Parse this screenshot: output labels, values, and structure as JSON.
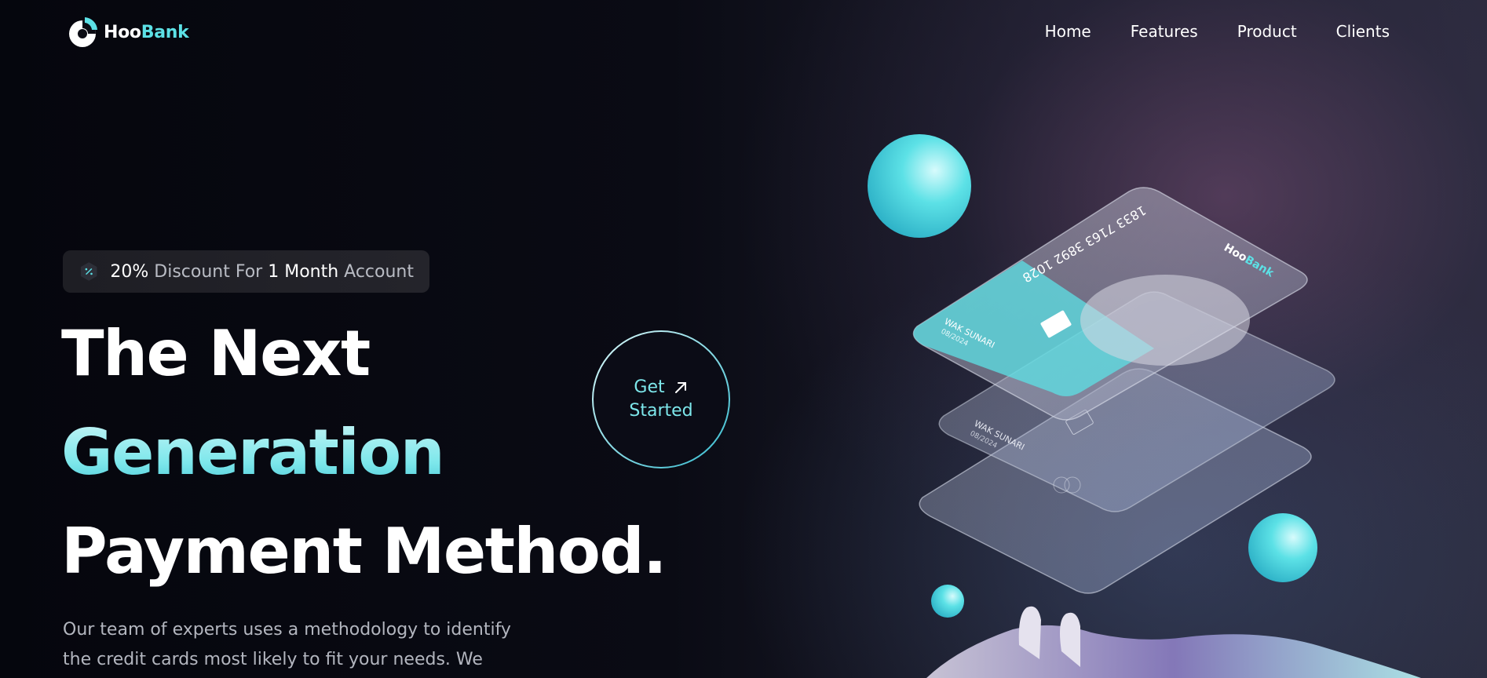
{
  "brand": {
    "name_part1": "Hoo",
    "name_part2": "Bank",
    "accent_color": "#5ce1e6"
  },
  "nav": {
    "items": [
      "Home",
      "Features",
      "Product",
      "Clients"
    ]
  },
  "badge": {
    "icon": "discount-icon",
    "percent": "20%",
    "text1": " Discount For ",
    "months": "1 Month",
    "text2": " Account"
  },
  "hero": {
    "line1": "The Next",
    "line2": "Generation",
    "line3": "Payment Method.",
    "paragraph": "Our team of experts uses a methodology to identify the credit cards most likely to fit your needs. We"
  },
  "cta": {
    "line1": "Get",
    "line2": "Started",
    "icon": "arrow-up-right-icon"
  },
  "card": {
    "number": "1833 7163 3892 1028",
    "brand_part1": "Hoo",
    "brand_part2": "Bank",
    "holder": "WAK SUNARI",
    "expiry": "08/2024"
  }
}
